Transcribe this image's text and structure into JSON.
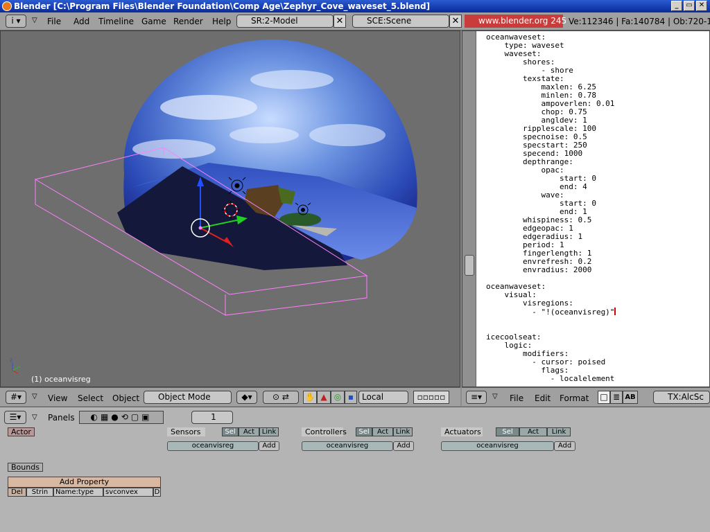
{
  "window": {
    "title": "Blender [C:\\Program Files\\Blender Foundation\\Comp Age\\Zephyr_Cove_waveset_5.blend]",
    "minimize_label": "_",
    "maximize_label": "▭",
    "close_label": "✕"
  },
  "topmenu": {
    "items": [
      "File",
      "Add",
      "Timeline",
      "Game",
      "Render",
      "Help"
    ],
    "screen_field": "SR:2-Model",
    "scene_field": "SCE:Scene",
    "website": "www.blender.org 245",
    "stats": "Ve:112346 | Fa:140784 | Ob:720-1"
  },
  "view3d": {
    "object_label": "(1) oceanvisreg",
    "header": {
      "menus": [
        "View",
        "Select",
        "Object"
      ],
      "mode": "Object Mode",
      "orientation": "Local"
    }
  },
  "texteditor": {
    "lines": [
      "oceanwaveset:",
      "    type: waveset",
      "    waveset:",
      "        shores:",
      "            - shore",
      "        texstate:",
      "            maxlen: 6.25",
      "            minlen: 0.78",
      "            ampoverlen: 0.01",
      "            chop: 0.75",
      "            angldev: 1",
      "        ripplescale: 100",
      "        specnoise: 0.5",
      "        specstart: 250",
      "        specend: 1000",
      "        depthrange:",
      "            opac:",
      "                start: 0",
      "                end: 4",
      "            wave:",
      "                start: 0",
      "                end: 1",
      "        whispiness: 0.5",
      "        edgeopac: 1",
      "        edgeradius: 1",
      "        period: 1",
      "        fingerlength: 1",
      "        envrefresh: 0.2",
      "        envradius: 2000",
      "",
      "oceanwaveset:",
      "    visual:",
      "        visregions:",
      "          - \"!(oceanvisreg)\"",
      "",
      "",
      "icecoolseat:",
      "    logic:",
      "        modifiers:",
      "          - cursor: poised",
      "            flags:",
      "              - localelement"
    ],
    "header": {
      "menus": [
        "File",
        "Edit",
        "Format"
      ],
      "text_field": "TX:AlcSc",
      "ab_label": "AB"
    }
  },
  "buttons": {
    "panels_label": "Panels",
    "frame_value": "1",
    "actor_label": "Actor",
    "bounds_label": "Bounds",
    "add_property_label": "Add Property",
    "property_row": {
      "del": "Del",
      "type": "Strin",
      "name": "Name:type",
      "value": "svconvex",
      "d": "D"
    },
    "columns": [
      {
        "title": "Sensors",
        "sel": "Sel",
        "act": "Act",
        "link": "Link",
        "object": "oceanvisreg",
        "add": "Add"
      },
      {
        "title": "Controllers",
        "sel": "Sel",
        "act": "Act",
        "link": "Link",
        "object": "oceanvisreg",
        "add": "Add"
      },
      {
        "title": "Actuators",
        "sel": "Sel",
        "act": "Act",
        "link": "Link",
        "object": "oceanvisreg",
        "add": "Add"
      }
    ]
  },
  "colors": {
    "title_bar": "#0a2a9a",
    "header_bg": "#a0a0a0",
    "viewport_bg": "#6e6e6e",
    "bounding_box": "#ff80ff",
    "cursor": "#d00000"
  }
}
